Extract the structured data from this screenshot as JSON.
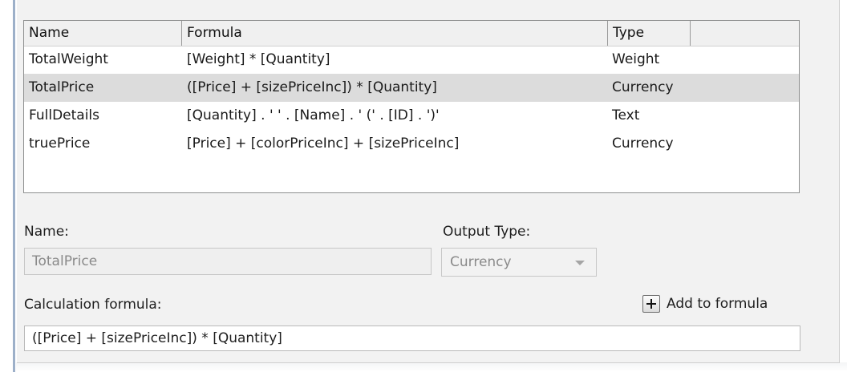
{
  "table": {
    "headers": {
      "name": "Name",
      "formula": "Formula",
      "type": "Type"
    },
    "rows": [
      {
        "name": "TotalWeight",
        "formula": "[Weight] * [Quantity]",
        "type": "Weight",
        "selected": false
      },
      {
        "name": "TotalPrice",
        "formula": "([Price] + [sizePriceInc]) * [Quantity]",
        "type": "Currency",
        "selected": true
      },
      {
        "name": "FullDetails",
        "formula": "[Quantity] . ' ' . [Name] . ' (' . [ID] . ')'",
        "type": "Text",
        "selected": false
      },
      {
        "name": "truePrice",
        "formula": "[Price] + [colorPriceInc] + [sizePriceInc]",
        "type": "Currency",
        "selected": false
      }
    ]
  },
  "form": {
    "name_label": "Name:",
    "name_value": "TotalPrice",
    "output_type_label": "Output Type:",
    "output_type_value": "Currency",
    "calc_label": "Calculation formula:",
    "add_to_formula_label": "Add to formula",
    "formula_value": "([Price] + [sizePriceInc]) * [Quantity]"
  },
  "colors": {
    "selected_row": "#dcdcdc",
    "panel_bg": "#f2f2f2",
    "window_edge": "#9db0c9"
  }
}
